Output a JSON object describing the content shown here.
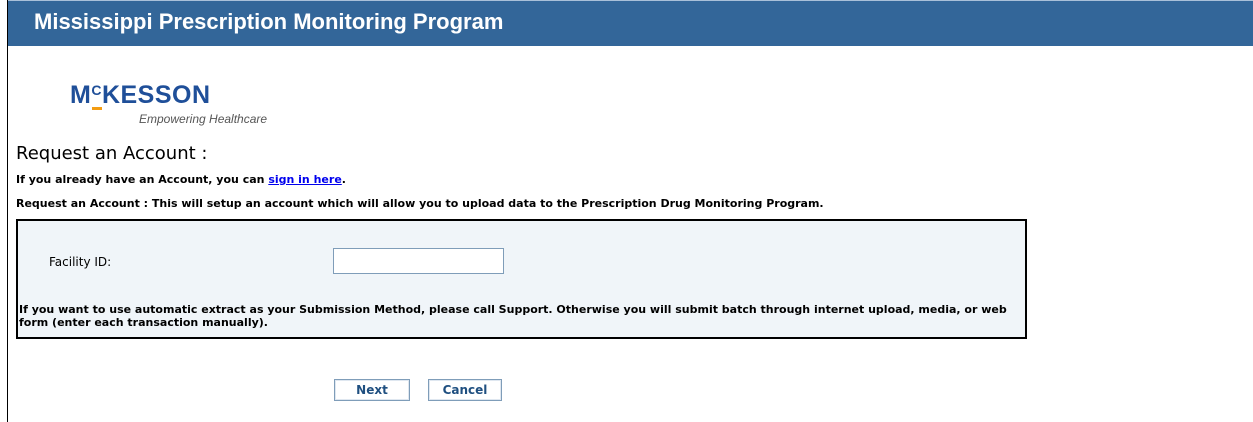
{
  "header": {
    "title": "Mississippi Prescription Monitoring Program"
  },
  "logo": {
    "brand_prefix": "M",
    "brand_sup": "C",
    "brand_rest": "KESSON",
    "tagline": "Empowering Healthcare",
    "colors": {
      "wordmark": "#1f4f99",
      "accent": "#f39c12"
    }
  },
  "page": {
    "title": "Request an Account :",
    "signin_prefix": "If you already have an Account, you can ",
    "signin_link": "sign in here",
    "signin_suffix": ".",
    "description": "Request an Account : This will setup an account which will allow you to upload data to the Prescription Drug Monitoring Program."
  },
  "form": {
    "facility_label": "Facility ID:",
    "facility_value": "",
    "note": "If you want to use automatic extract as your Submission Method, please call Support. Otherwise you will submit batch through internet upload, media, or web form (enter each transaction manually)."
  },
  "buttons": {
    "next": "Next",
    "cancel": "Cancel"
  },
  "colors": {
    "header_bg": "#336699",
    "form_bg": "#f0f5f9",
    "link": "#0000ee"
  }
}
